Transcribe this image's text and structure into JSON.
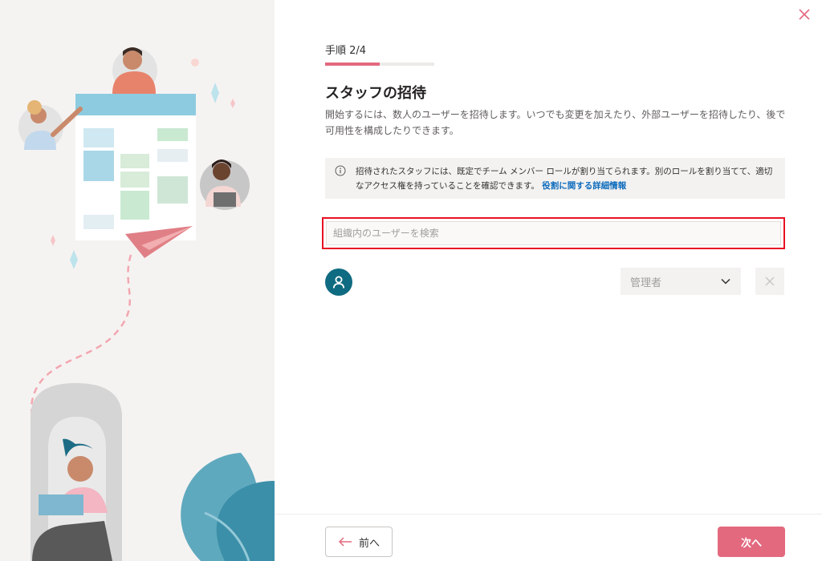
{
  "step": {
    "label": "手順 2/4",
    "progress_fraction": 0.5
  },
  "title": "スタッフの招待",
  "description": "開始するには、数人のユーザーを招待します。いつでも変更を加えたり、外部ユーザーを招待したり、後で可用性を構成したりできます。",
  "info": {
    "text": "招待されたスタッフには、既定でチーム メンバー ロールが割り当てられます。別のロールを割り当てて、適切なアクセス権を持っていることを確認できます。",
    "link": "役割に関する詳細情報",
    "icon": "info-icon"
  },
  "search": {
    "placeholder": "組織内のユーザーを検索",
    "value": ""
  },
  "staff_row": {
    "avatar_icon": "person-icon",
    "role": "管理者",
    "role_icon": "chevron-down-icon",
    "remove_icon": "close-icon"
  },
  "footer": {
    "back_label": "前へ",
    "back_icon": "arrow-left-icon",
    "next_label": "次へ"
  },
  "colors": {
    "accent": "#e3697f",
    "highlight_border": "#e81123",
    "link": "#0f6cbd",
    "avatar": "#0f6b81"
  }
}
